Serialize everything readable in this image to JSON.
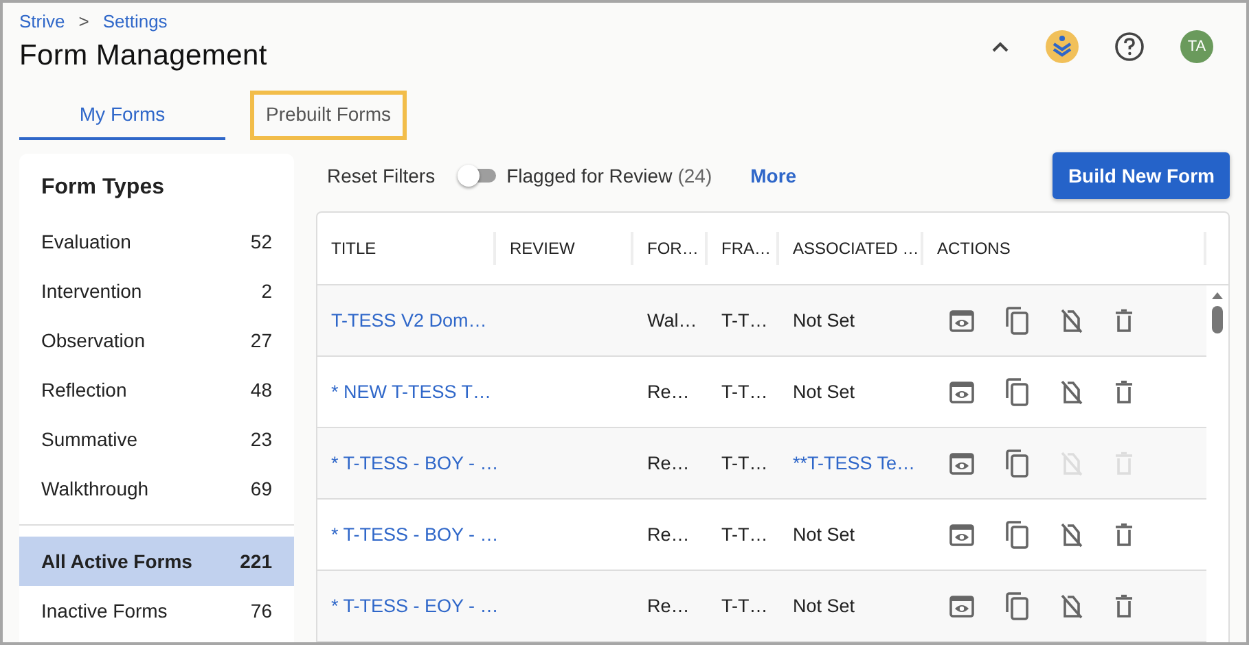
{
  "breadcrumb": [
    {
      "label": "Strive"
    },
    {
      "label": "Settings"
    }
  ],
  "breadcrumb_separator": ">",
  "title": "Form Management",
  "header_actions": {
    "avatar": "TA"
  },
  "tabs": [
    {
      "label": "My Forms",
      "selected": true,
      "highlighted": false
    },
    {
      "label": "Prebuilt Forms",
      "selected": false,
      "highlighted": true
    }
  ],
  "sidebar": {
    "heading": "Form Types",
    "items": [
      {
        "label": "Evaluation",
        "count": "52",
        "selected": false
      },
      {
        "label": "Intervention",
        "count": "2",
        "selected": false
      },
      {
        "label": "Observation",
        "count": "27",
        "selected": false
      },
      {
        "label": "Reflection",
        "count": "48",
        "selected": false
      },
      {
        "label": "Summative",
        "count": "23",
        "selected": false
      },
      {
        "label": "Walkthrough",
        "count": "69",
        "selected": false
      }
    ],
    "status_items": [
      {
        "label": "All Active Forms",
        "count": "221",
        "selected": true
      },
      {
        "label": "Inactive Forms",
        "count": "76",
        "selected": false
      }
    ]
  },
  "toolbar": {
    "reset": "Reset Filters",
    "flag_toggle": {
      "label": "Flagged for Review",
      "count": "(24)",
      "on": false
    },
    "more": "More",
    "build": "Build New Form"
  },
  "table": {
    "columns": [
      "TITLE",
      "REVIEW",
      "FOR…",
      "FRA…",
      "ASSOCIATED …",
      "ACTIONS"
    ],
    "rows": [
      {
        "title": "T-TESS V2 Dom…",
        "form_type": "Wal…",
        "framework": "T-T…",
        "associated": {
          "text": "Not Set",
          "link": false
        },
        "unlink_disabled": false,
        "delete_disabled": false
      },
      {
        "title": "* NEW T-TESS T…",
        "form_type": "Re…",
        "framework": "T-T…",
        "associated": {
          "text": "Not Set",
          "link": false
        },
        "unlink_disabled": false,
        "delete_disabled": false
      },
      {
        "title": "* T-TESS - BOY - …",
        "form_type": "Re…",
        "framework": "T-T…",
        "associated": {
          "text": "**T-TESS Te…",
          "link": true
        },
        "unlink_disabled": true,
        "delete_disabled": true
      },
      {
        "title": "* T-TESS - BOY - …",
        "form_type": "Re…",
        "framework": "T-T…",
        "associated": {
          "text": "Not Set",
          "link": false
        },
        "unlink_disabled": false,
        "delete_disabled": false
      },
      {
        "title": "* T-TESS - EOY - …",
        "form_type": "Re…",
        "framework": "T-T…",
        "associated": {
          "text": "Not Set",
          "link": false
        },
        "unlink_disabled": false,
        "delete_disabled": false
      }
    ]
  }
}
